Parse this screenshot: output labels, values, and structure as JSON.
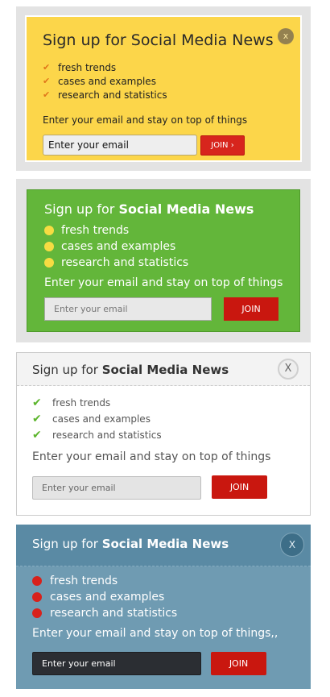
{
  "panels": [
    {
      "title": "Sign up for Social Media News",
      "items": [
        "fresh trends",
        "cases and examples",
        "research and statistics"
      ],
      "subtitle": "Enter your email and stay on top of things",
      "email_value": "Enter your email",
      "join_label": "JOIN ›",
      "close_label": "x",
      "accent": "#fcd64a"
    },
    {
      "title_prefix": "Sign up for ",
      "title_strong": "Social Media News",
      "items": [
        "fresh trends",
        "cases and examples",
        "research and statistics"
      ],
      "subtitle": "Enter your email and stay on top of things",
      "email_placeholder": "Enter your email",
      "join_label": "JOIN",
      "accent": "#63b63a"
    },
    {
      "title_prefix": "Sign up for ",
      "title_strong": "Social Media News",
      "items": [
        "fresh trends",
        "cases and examples",
        "research and statistics"
      ],
      "subtitle": "Enter your email and stay on top of things",
      "email_placeholder": "Enter your email",
      "join_label": "JOIN",
      "close_label": "X",
      "accent": "#f3f3f3"
    },
    {
      "title_prefix": "Sign up for ",
      "title_strong": "Social Media News",
      "items": [
        "fresh trends",
        "cases and examples",
        "research and statistics"
      ],
      "subtitle": "Enter your email and stay on top of things,,",
      "email_value": "Enter your email",
      "join_label": "JOIN",
      "close_label": "X",
      "accent": "#6f9bb2"
    }
  ],
  "icons": {
    "check": "check-icon",
    "bullet": "bullet-dot-icon",
    "close": "close-icon"
  }
}
